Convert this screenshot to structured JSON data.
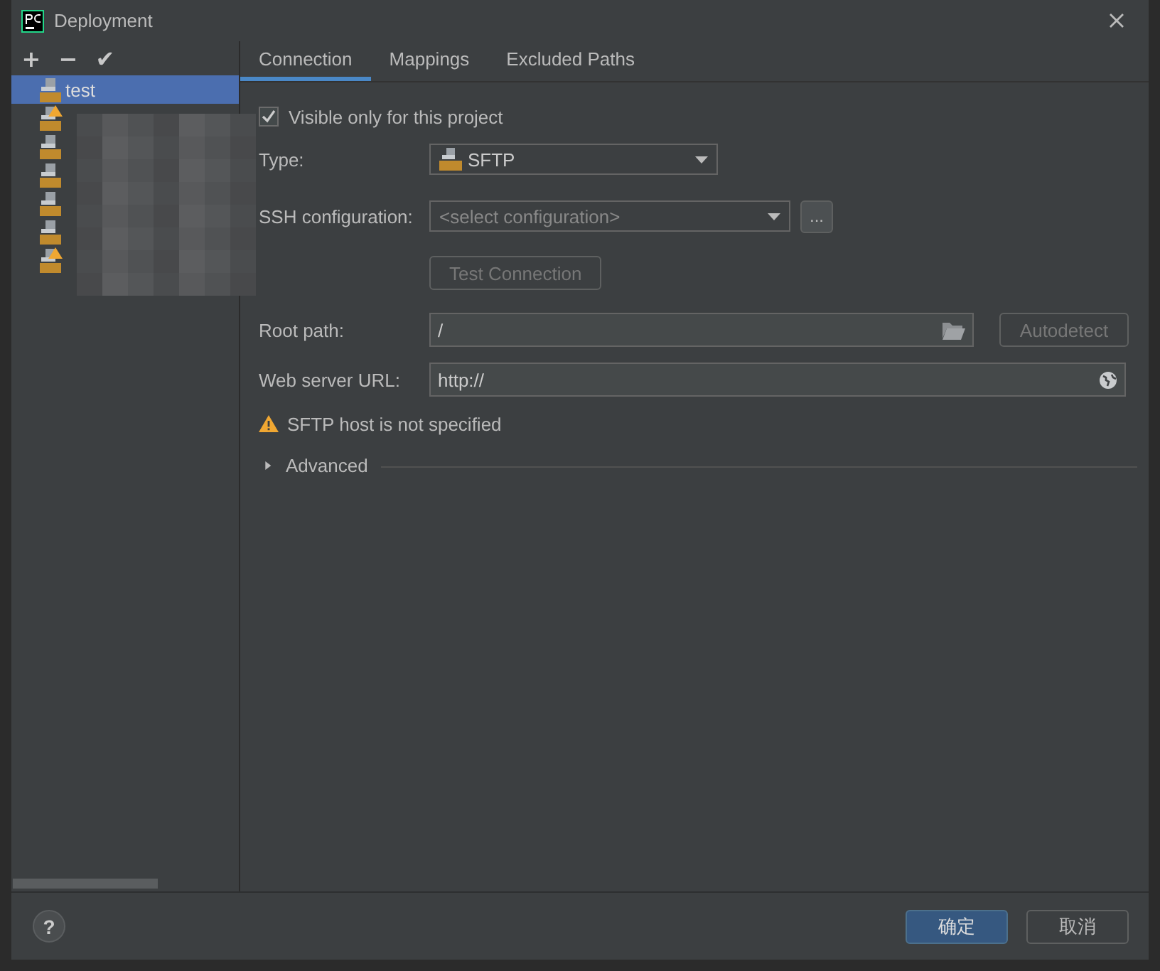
{
  "window": {
    "title": "Deployment"
  },
  "toolbar": [
    "+",
    "−",
    "✔"
  ],
  "servers": [
    {
      "label": "test",
      "selected": true,
      "warning": false
    },
    {
      "selected": false,
      "warning": true
    },
    {
      "selected": false,
      "warning": false
    },
    {
      "selected": false,
      "warning": false
    },
    {
      "selected": false,
      "warning": false
    },
    {
      "selected": false,
      "warning": false
    },
    {
      "selected": false,
      "warning": true
    }
  ],
  "tabs": [
    {
      "label": "Connection",
      "selected": true
    },
    {
      "label": "Mappings",
      "selected": false
    },
    {
      "label": "Excluded Paths",
      "selected": false
    }
  ],
  "visible_only": {
    "label": "Visible only for this project",
    "checked": true
  },
  "type": {
    "label": "Type:",
    "value": "SFTP"
  },
  "ssh": {
    "label": "SSH configuration:",
    "placeholder": "<select configuration>",
    "more": "..."
  },
  "test_button": {
    "label": "Test Connection",
    "disabled": true
  },
  "root_path": {
    "label": "Root path:",
    "value": "/",
    "button": "Autodetect"
  },
  "web_url": {
    "label": "Web server URL:",
    "value": "http://"
  },
  "warning": "SFTP host is not specified",
  "advanced": {
    "label": "Advanced",
    "expanded": false
  },
  "help": "?",
  "buttons": [
    {
      "label": "确定",
      "primary": true
    },
    {
      "label": "取消",
      "primary": false
    }
  ]
}
